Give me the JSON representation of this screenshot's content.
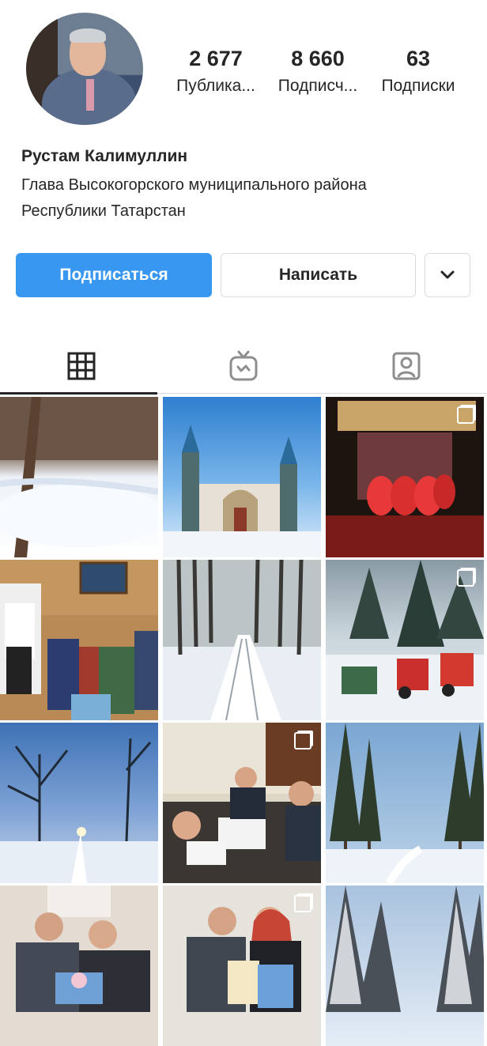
{
  "profile": {
    "name": "Рустам Калимуллин",
    "bio_line1": "Глава Высокогорского муниципального района",
    "bio_line2": "Республики Татарстан"
  },
  "stats": [
    {
      "value": "2 677",
      "label": "Публика..."
    },
    {
      "value": "8 660",
      "label": "Подписч..."
    },
    {
      "value": "63",
      "label": "Подписки"
    }
  ],
  "actions": {
    "follow_label": "Подписаться",
    "message_label": "Написать",
    "more_icon": "chevron-down-icon"
  },
  "tabs": [
    {
      "icon": "grid-icon",
      "active": true
    },
    {
      "icon": "igtv-icon",
      "active": false
    },
    {
      "icon": "tagged-icon",
      "active": false
    }
  ],
  "colors": {
    "accent": "#3897f0",
    "text": "#262626",
    "border": "#dbdbdb"
  },
  "posts": [
    {
      "subject": "winter forest trees",
      "multi": false
    },
    {
      "subject": "mosque building",
      "multi": false
    },
    {
      "subject": "stage dance performance",
      "multi": true
    },
    {
      "subject": "visit to elderly women",
      "multi": false
    },
    {
      "subject": "snowy birch road",
      "multi": false
    },
    {
      "subject": "red tractors in snow",
      "multi": true
    },
    {
      "subject": "sunset winter trees",
      "multi": false
    },
    {
      "subject": "meeting at table",
      "multi": true
    },
    {
      "subject": "pine forest in snow",
      "multi": false
    },
    {
      "subject": "man and woman with flowers",
      "multi": false
    },
    {
      "subject": "award ceremony",
      "multi": true
    },
    {
      "subject": "snowy forest",
      "multi": false
    }
  ]
}
